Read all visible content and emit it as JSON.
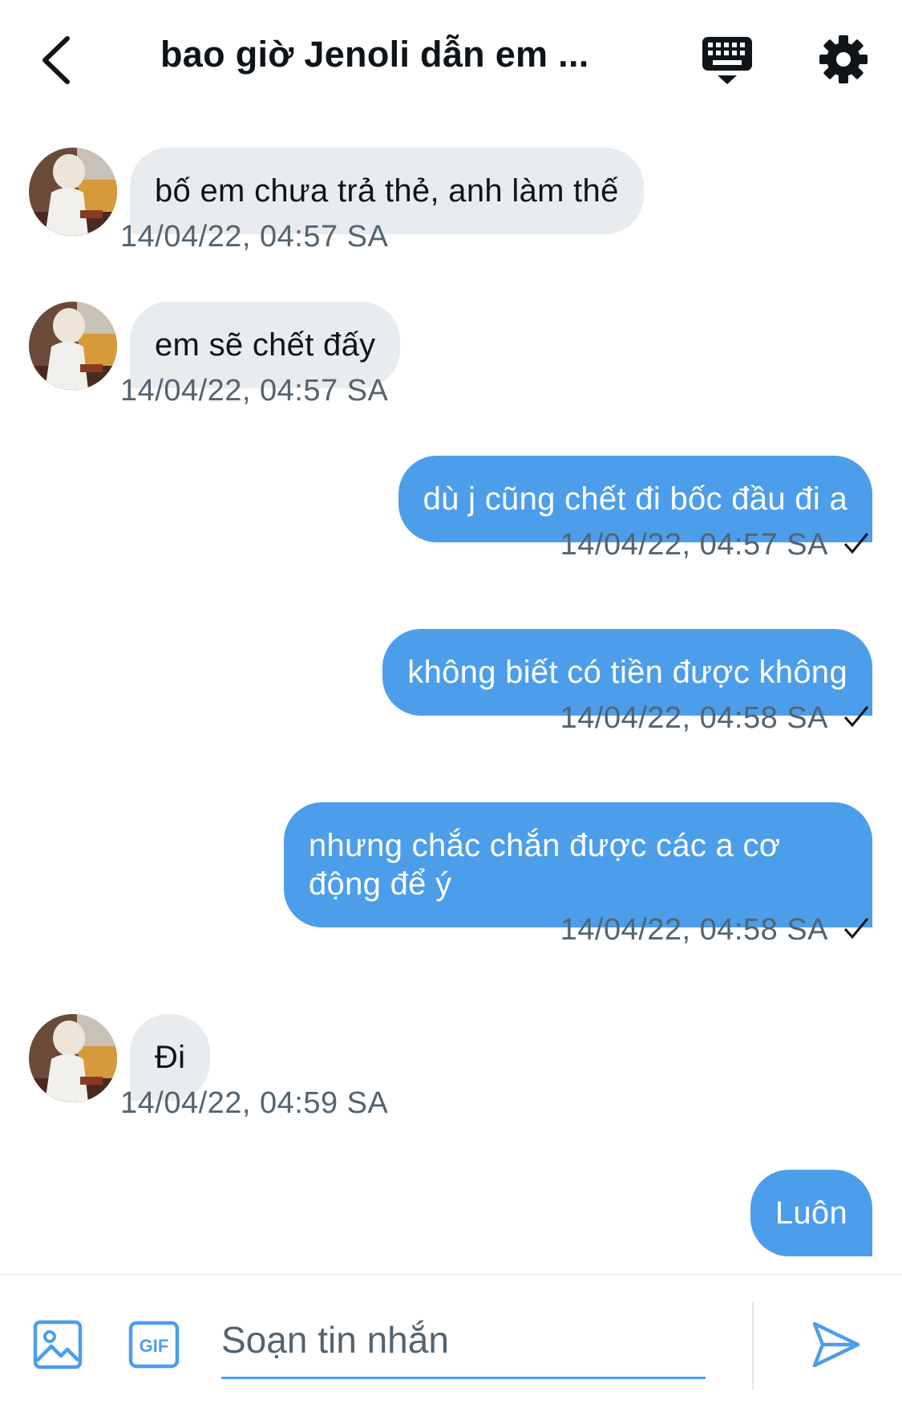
{
  "header": {
    "title": "bao giờ Jenoli dẫn em ...",
    "back_icon": "chevron-left-icon",
    "keyboard_icon": "keyboard-icon",
    "settings_icon": "gear-icon"
  },
  "messages": [
    {
      "direction": "incoming",
      "text": "bố em chưa trả thẻ, anh làm thế",
      "time": "14/04/22, 04:57 SA"
    },
    {
      "direction": "incoming",
      "text": "em sẽ chết đấy",
      "time": "14/04/22, 04:57 SA"
    },
    {
      "direction": "outgoing",
      "text": "dù j cũng chết đi bốc đầu đi a",
      "time": "14/04/22, 04:57 SA",
      "read": true
    },
    {
      "direction": "outgoing",
      "text": "không biết có tiền được không",
      "time": "14/04/22, 04:58 SA",
      "read": true
    },
    {
      "direction": "outgoing",
      "text": "nhưng chắc chắn được các a cơ động để ý",
      "time": "14/04/22, 04:58 SA",
      "read": true
    },
    {
      "direction": "incoming",
      "text": "Đi",
      "time": "14/04/22, 04:59 SA"
    },
    {
      "direction": "outgoing",
      "text": "Luôn",
      "time": "",
      "read": true
    }
  ],
  "composer": {
    "placeholder": "Soạn tin nhắn",
    "value": "",
    "image_icon": "image-icon",
    "gif_icon": "gif-icon",
    "send_icon": "send-icon"
  },
  "colors": {
    "accent": "#4c9eeb",
    "incoming_bubble": "#e9ecef",
    "secondary_text": "#536471"
  }
}
